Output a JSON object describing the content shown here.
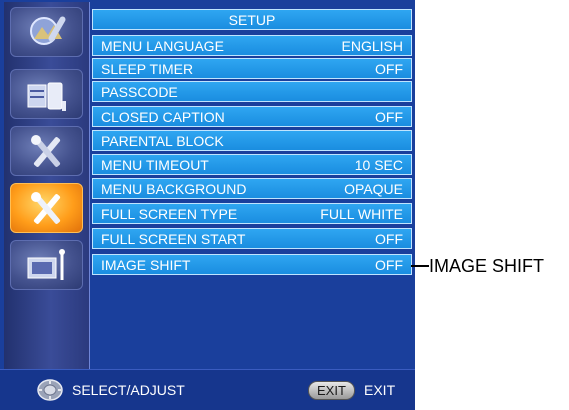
{
  "menu": {
    "title": "SETUP",
    "items": [
      {
        "label": "MENU LANGUAGE",
        "value": "ENGLISH"
      },
      {
        "label": "SLEEP TIMER",
        "value": "OFF"
      },
      {
        "label": "PASSCODE",
        "value": ""
      },
      {
        "label": "CLOSED CAPTION",
        "value": "OFF"
      },
      {
        "label": "PARENTAL BLOCK",
        "value": ""
      },
      {
        "label": "MENU TIMEOUT",
        "value": "10 SEC"
      },
      {
        "label": "MENU BACKGROUND",
        "value": "OPAQUE"
      },
      {
        "label": "FULL SCREEN TYPE",
        "value": "FULL WHITE"
      },
      {
        "label": "FULL SCREEN START",
        "value": "OFF"
      },
      {
        "label": "IMAGE SHIFT",
        "value": "OFF"
      }
    ]
  },
  "sidebar": {
    "categories": [
      {
        "icon": "picture-adjust-icon",
        "active": false
      },
      {
        "icon": "image-config-icon",
        "active": false
      },
      {
        "icon": "tools-icon",
        "active": false
      },
      {
        "icon": "setup-tools-icon",
        "active": true
      },
      {
        "icon": "tv-antenna-icon",
        "active": false
      }
    ]
  },
  "footer": {
    "select_label": "SELECT/ADJUST",
    "exit_button": "EXIT",
    "exit_label": "EXIT"
  },
  "callout": {
    "label": "IMAGE SHIFT"
  },
  "colors": {
    "panel_bg": "#1a3f9c",
    "row_bg": "#2299ea",
    "row_border": "#bfe4ff",
    "active_category": "#ff9d1a"
  }
}
